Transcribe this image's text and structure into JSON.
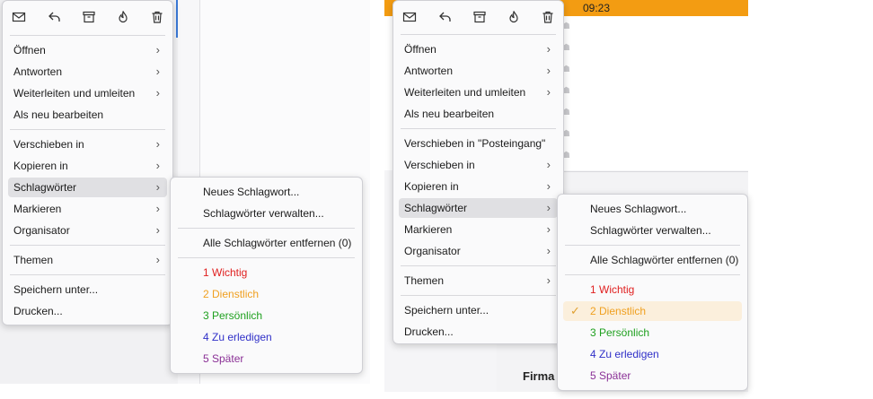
{
  "scenes": [
    {
      "context_menu": {
        "toolbar_icons": [
          "archive-icon",
          "reply-icon",
          "archive-box-icon",
          "junk-icon",
          "delete-icon"
        ],
        "items": [
          {
            "label": "Öffnen"
          },
          {
            "label": "Antworten"
          },
          {
            "label": "Weiterleiten und umleiten"
          },
          {
            "label": "Als neu bearbeiten"
          },
          {
            "label": "Verschieben in"
          },
          {
            "label": "Kopieren in"
          },
          {
            "label": "Schlagwörter"
          },
          {
            "label": "Markieren"
          },
          {
            "label": "Organisator"
          },
          {
            "label": "Themen"
          },
          {
            "label": "Speichern unter..."
          },
          {
            "label": "Drucken..."
          }
        ]
      },
      "submenu": {
        "items": [
          {
            "label": "Neues Schlagwort..."
          },
          {
            "label": "Schlagwörter verwalten..."
          },
          {
            "label": "Alle Schlagwörter entfernen (0)"
          },
          {
            "label": "1 Wichtig",
            "color": "#e02020"
          },
          {
            "label": "2 Dienstlich",
            "color": "#f0a020"
          },
          {
            "label": "3 Persönlich",
            "color": "#1fa01f"
          },
          {
            "label": "4 Zu erledigen",
            "color": "#3030c8"
          },
          {
            "label": "5 Später",
            "color": "#8a3096"
          }
        ]
      }
    },
    {
      "header": {
        "time": "09:23"
      },
      "preview": {
        "sender_label": "Firma"
      },
      "context_menu": {
        "toolbar_icons": [
          "archive-icon",
          "reply-icon",
          "archive-box-icon",
          "junk-icon",
          "delete-icon"
        ],
        "items": [
          {
            "label": "Öffnen"
          },
          {
            "label": "Antworten"
          },
          {
            "label": "Weiterleiten und umleiten"
          },
          {
            "label": "Als neu bearbeiten"
          },
          {
            "label": "Verschieben in \"Posteingang\""
          },
          {
            "label": "Verschieben in"
          },
          {
            "label": "Kopieren in"
          },
          {
            "label": "Schlagwörter"
          },
          {
            "label": "Markieren"
          },
          {
            "label": "Organisator"
          },
          {
            "label": "Themen"
          },
          {
            "label": "Speichern unter..."
          },
          {
            "label": "Drucken..."
          }
        ]
      },
      "submenu": {
        "items": [
          {
            "label": "Neues Schlagwort..."
          },
          {
            "label": "Schlagwörter verwalten..."
          },
          {
            "label": "Alle Schlagwörter entfernen (0)"
          },
          {
            "label": "1 Wichtig",
            "color": "#e02020"
          },
          {
            "label": "2 Dienstlich",
            "color": "#f0a020",
            "checked": true
          },
          {
            "label": "3 Persönlich",
            "color": "#1fa01f"
          },
          {
            "label": "4 Zu erledigen",
            "color": "#3030c8"
          },
          {
            "label": "5 Später",
            "color": "#8a3096"
          }
        ]
      }
    }
  ]
}
